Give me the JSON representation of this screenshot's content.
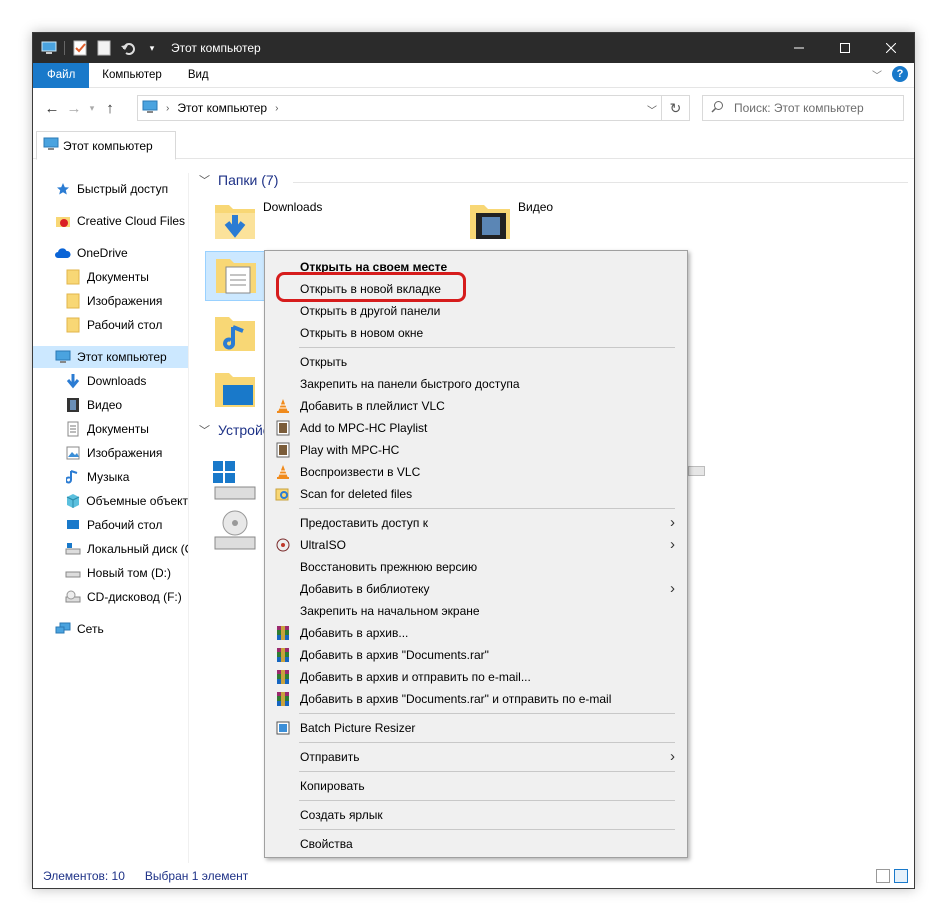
{
  "window": {
    "title": "Этот компьютер",
    "accent": "#1979ca"
  },
  "ribbon": {
    "tabs": [
      "Файл",
      "Компьютер",
      "Вид"
    ]
  },
  "address": {
    "path": "Этот компьютер",
    "search_placeholder": "Поиск: Этот компьютер"
  },
  "tab": {
    "label": "Этот компьютер"
  },
  "nav": {
    "items": [
      {
        "label": "Быстрый доступ",
        "icon": "star-icon"
      },
      {
        "label": "Creative Cloud Files",
        "icon": "creative-cloud-icon"
      },
      {
        "label": "OneDrive",
        "icon": "cloud-icon"
      },
      {
        "label": "Документы",
        "icon": "folder-icon"
      },
      {
        "label": "Изображения",
        "icon": "folder-icon"
      },
      {
        "label": "Рабочий стол",
        "icon": "folder-icon"
      },
      {
        "label": "Этот компьютер",
        "icon": "computer-icon"
      },
      {
        "label": "Downloads",
        "icon": "download-icon"
      },
      {
        "label": "Видео",
        "icon": "video-icon"
      },
      {
        "label": "Документы",
        "icon": "document-icon"
      },
      {
        "label": "Изображения",
        "icon": "image-icon"
      },
      {
        "label": "Музыка",
        "icon": "music-icon"
      },
      {
        "label": "Объемные объект",
        "icon": "3d-objects-icon"
      },
      {
        "label": "Рабочий стол",
        "icon": "desktop-icon"
      },
      {
        "label": "Локальный диск (C:)",
        "icon": "drive-icon"
      },
      {
        "label": "Новый том (D:)",
        "icon": "drive-icon"
      },
      {
        "label": "CD-дисковод (F:)",
        "icon": "cd-drive-icon"
      },
      {
        "label": "Сеть",
        "icon": "network-icon"
      }
    ]
  },
  "content": {
    "folders_header": "Папки (7)",
    "devices_header": "Устройс",
    "folders": [
      {
        "label": "Downloads"
      },
      {
        "label": "Видео"
      }
    ]
  },
  "status": {
    "count": "Элементов: 10",
    "selected": "Выбран 1 элемент"
  },
  "menu": {
    "items": [
      {
        "label": "Открыть на своем месте",
        "bold": true
      },
      {
        "label": "Открыть в новой вкладке"
      },
      {
        "label": "Открыть в другой панели"
      },
      {
        "label": "Открыть в новом окне"
      },
      {
        "label": "Открыть"
      },
      {
        "label": "Закрепить на панели быстрого доступа"
      },
      {
        "label": "Добавить в плейлист VLC",
        "icon": "vlc-icon"
      },
      {
        "label": "Add to MPC-HC Playlist",
        "icon": "mpc-hc-icon"
      },
      {
        "label": "Play with MPC-HC",
        "icon": "mpc-hc-icon"
      },
      {
        "label": "Воспроизвести в VLC",
        "icon": "vlc-icon"
      },
      {
        "label": "Scan for deleted files",
        "icon": "scan-icon"
      },
      {
        "label": "Предоставить доступ к",
        "submenu": true
      },
      {
        "label": "UltraISO",
        "icon": "ultraiso-icon",
        "submenu": true
      },
      {
        "label": "Восстановить прежнюю версию"
      },
      {
        "label": "Добавить в библиотеку",
        "submenu": true
      },
      {
        "label": "Закрепить на начальном экране"
      },
      {
        "label": "Добавить в архив...",
        "icon": "winrar-icon"
      },
      {
        "label": "Добавить в архив \"Documents.rar\"",
        "icon": "winrar-icon"
      },
      {
        "label": "Добавить в архив и отправить по e-mail...",
        "icon": "winrar-icon"
      },
      {
        "label": "Добавить в архив \"Documents.rar\" и отправить по e-mail",
        "icon": "winrar-icon"
      },
      {
        "label": "Batch Picture Resizer",
        "icon": "resizer-icon"
      },
      {
        "label": "Отправить",
        "submenu": true
      },
      {
        "label": "Копировать"
      },
      {
        "label": "Создать ярлык"
      },
      {
        "label": "Свойства"
      }
    ]
  }
}
